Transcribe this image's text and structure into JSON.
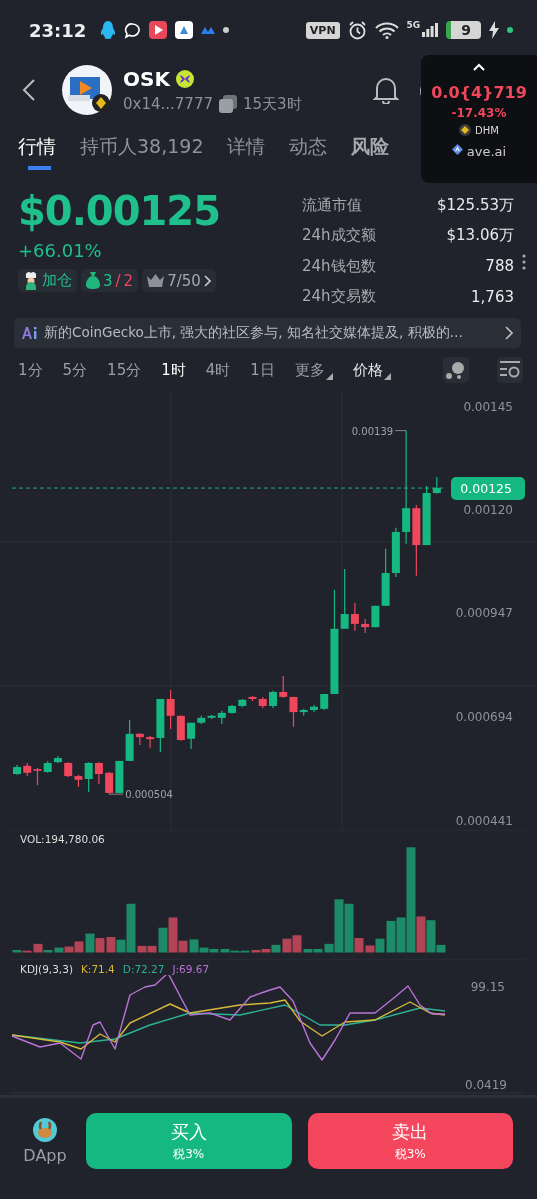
{
  "status_bar": {
    "time": "23:12",
    "vpn": "VPN",
    "network": "5G",
    "battery": "9"
  },
  "header": {
    "title": "OSK",
    "address": "0x14...7777",
    "age": "15天3时"
  },
  "tabs": [
    {
      "label": "行情",
      "selected": true
    },
    {
      "label": "持币人38,192",
      "selected": false
    },
    {
      "label": "详情",
      "selected": false
    },
    {
      "label": "动态",
      "selected": false
    },
    {
      "label": "风险",
      "selected": false,
      "kind": "bold"
    }
  ],
  "floating_ticker": {
    "price": "0.0{4}719",
    "change": "-17.43%",
    "chain": "DHM",
    "source": "ave.ai"
  },
  "price": {
    "value": "$0.00125",
    "change": "+66.01%"
  },
  "badges": {
    "add_label": "加仓",
    "buys": "3",
    "separator": "/",
    "sells": "2",
    "rank": "7/50"
  },
  "stats": [
    {
      "label": "流通市值",
      "value": "$125.53万"
    },
    {
      "label": "24h成交额",
      "value": "$13.06万"
    },
    {
      "label": "24h钱包数",
      "value": "788"
    },
    {
      "label": "24h交易数",
      "value": "1,763"
    }
  ],
  "ai_summary": "新的CoinGecko上市, 强大的社区参与, 知名社交媒体提及, 积极的…",
  "timeframes": [
    {
      "label": "1分",
      "selected": false
    },
    {
      "label": "5分",
      "selected": false
    },
    {
      "label": "15分",
      "selected": false
    },
    {
      "label": "1时",
      "selected": true
    },
    {
      "label": "4时",
      "selected": false
    },
    {
      "label": "1日",
      "selected": false
    }
  ],
  "dropdowns": [
    {
      "label": "更多",
      "kind": "muted"
    },
    {
      "label": "价格",
      "kind": "bright"
    }
  ],
  "price_chart": {
    "current_price": "0.00125",
    "high_label": "0.00139",
    "low_label": "0.000504",
    "chart_data": {
      "type": "candlestick",
      "ylim": [
        0.000441,
        0.00145
      ],
      "yticks": [
        {
          "value": 0.00145,
          "label": "0.00145"
        },
        {
          "value": 0.0012,
          "label": "0.00120"
        },
        {
          "value": 0.000947,
          "label": "0.000947"
        },
        {
          "value": 0.000694,
          "label": "0.000694"
        },
        {
          "value": 0.000441,
          "label": "0.000441"
        }
      ],
      "ohlc": [
        [
          0.000553,
          0.000575,
          0.000551,
          0.00057
        ],
        [
          0.000573,
          0.00058,
          0.000548,
          0.000556
        ],
        [
          0.000565,
          0.000568,
          0.000526,
          0.000561
        ],
        [
          0.000558,
          0.000585,
          0.000556,
          0.00058
        ],
        [
          0.000582,
          0.000597,
          0.00058,
          0.000592
        ],
        [
          0.00058,
          0.000582,
          0.000546,
          0.000548
        ],
        [
          0.000548,
          0.000551,
          0.000522,
          0.000539
        ],
        [
          0.000541,
          0.000582,
          0.000509,
          0.00058
        ],
        [
          0.00058,
          0.000582,
          0.000529,
          0.000553
        ],
        [
          0.000556,
          0.000558,
          0.000504,
          0.000507
        ],
        [
          0.000507,
          0.000585,
          0.000507,
          0.000585
        ],
        [
          0.000585,
          0.000685,
          0.000585,
          0.000651
        ],
        [
          0.000651,
          0.000653,
          0.000624,
          0.000643
        ],
        [
          0.000643,
          0.000646,
          0.000617,
          0.000638
        ],
        [
          0.000641,
          0.000736,
          0.000607,
          0.000736
        ],
        [
          0.000736,
          0.000758,
          0.000663,
          0.000695
        ],
        [
          0.000695,
          0.000695,
          0.000634,
          0.000636
        ],
        [
          0.000639,
          0.000678,
          0.000614,
          0.000678
        ],
        [
          0.000678,
          0.000695,
          0.000675,
          0.00069
        ],
        [
          0.00069,
          0.000697,
          0.000687,
          0.000695
        ],
        [
          0.00069,
          0.000707,
          0.000675,
          0.000702
        ],
        [
          0.000702,
          0.000721,
          0.0007,
          0.000719
        ],
        [
          0.000719,
          0.000736,
          0.000716,
          0.000734
        ],
        [
          0.000741,
          0.000743,
          0.000731,
          0.000736
        ],
        [
          0.000736,
          0.000741,
          0.000714,
          0.000719
        ],
        [
          0.000719,
          0.000756,
          0.000714,
          0.000753
        ],
        [
          0.000753,
          0.000792,
          0.000739,
          0.000741
        ],
        [
          0.000741,
          0.000741,
          0.000668,
          0.000704
        ],
        [
          0.000704,
          0.000712,
          0.000695,
          0.000709
        ],
        [
          0.000709,
          0.000721,
          0.000704,
          0.000717
        ],
        [
          0.000712,
          0.000748,
          0.000709,
          0.000748
        ],
        [
          0.000748,
          0.001002,
          0.000748,
          0.000907
        ],
        [
          0.000907,
          0.001053,
          0.000907,
          0.000943
        ],
        [
          0.000943,
          0.00097,
          0.000902,
          0.000919
        ],
        [
          0.000919,
          0.000931,
          0.000897,
          0.000911
        ],
        [
          0.000911,
          0.000963,
          0.000911,
          0.000963
        ],
        [
          0.000963,
          0.001102,
          0.000963,
          0.001043
        ],
        [
          0.001043,
          0.001153,
          0.001033,
          0.001143
        ],
        [
          0.001143,
          0.00139,
          0.001114,
          0.001201
        ],
        [
          0.001201,
          0.001209,
          0.001036,
          0.001111
        ],
        [
          0.001111,
          0.001255,
          0.001111,
          0.001238
        ],
        [
          0.001238,
          0.001277,
          0.001236,
          0.00125
        ]
      ]
    }
  },
  "volume": {
    "title": "VOL:194,780.06"
  },
  "kdj": {
    "title": "KDJ(9,3,3)",
    "values": [
      {
        "label": "K:71.4",
        "color": "#d6b93a"
      },
      {
        "label": "D:72.27",
        "color": "#2bb394"
      },
      {
        "label": "J:69.67",
        "color": "#b974d6"
      }
    ],
    "axis_labels": [
      "99.15",
      "0.0419"
    ]
  },
  "bottom_bar": {
    "dapp": "DApp",
    "buy": {
      "label": "买入",
      "tax": "税3%"
    },
    "sell": {
      "label": "卖出",
      "tax": "税3%"
    }
  }
}
